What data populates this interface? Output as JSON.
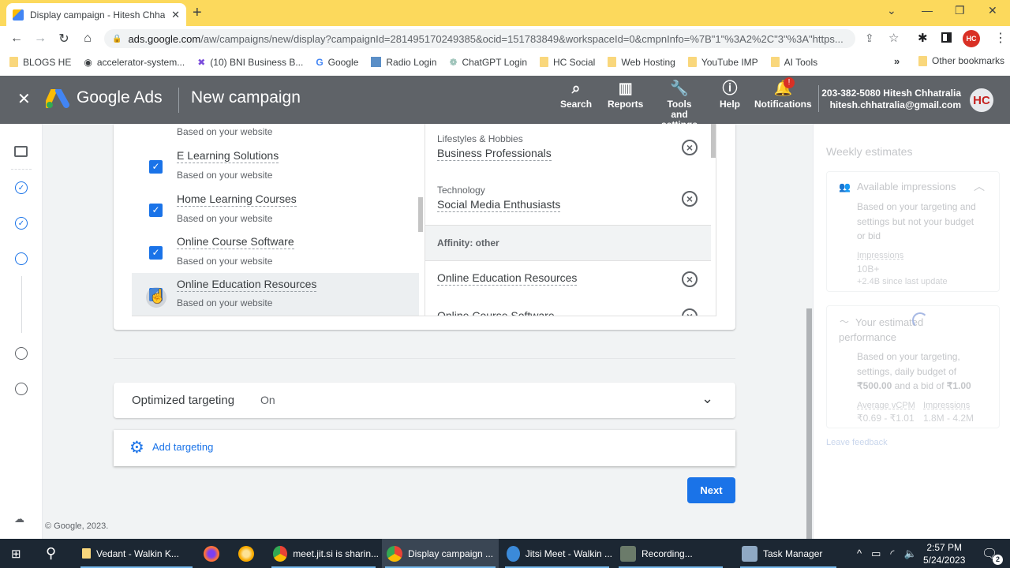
{
  "browser": {
    "tab_title": "Display campaign - Hitesh Chhatralia",
    "url_host": "ads.google.com",
    "url_path": "/aw/campaigns/new/display?campaignId=281495170249385&ocid=151783849&workspaceId=0&cmpnInfo=%7B\"1\"%3A2%2C\"3\"%3A\"https...",
    "bookmarks": [
      "BLOGS HE",
      "accelerator-system...",
      "(10) BNI Business B...",
      "Google",
      "Radio Login",
      "ChatGPT Login",
      "HC Social",
      "Web Hosting",
      "YouTube IMP",
      "AI Tools"
    ],
    "other_bookmarks": "Other bookmarks",
    "more_bookmarks": "»"
  },
  "header": {
    "brand": "Google Ads",
    "title": "New campaign",
    "buttons": [
      {
        "label": "Search",
        "icon": "search-icon"
      },
      {
        "label": "Reports",
        "icon": "reports-icon"
      },
      {
        "label": "Tools and settings",
        "icon": "wrench-icon"
      },
      {
        "label": "Help",
        "icon": "help-icon"
      },
      {
        "label": "Notifications",
        "icon": "bell-icon"
      }
    ],
    "notification_badge": "!",
    "account_line1": "203-382-5080 Hitesh Chhatralia",
    "account_line2": "hitesh.chhatralia@gmail.com",
    "avatar_initials": "HC"
  },
  "audience_list": {
    "top_partial_sub": "Based on your website",
    "items": [
      {
        "name": "E Learning Solutions",
        "sub": "Based on your website",
        "checked": true
      },
      {
        "name": "Home Learning Courses",
        "sub": "Based on your website",
        "checked": true
      },
      {
        "name": "Online Course Software",
        "sub": "Based on your website",
        "checked": true
      },
      {
        "name": "Online Education Resources",
        "sub": "Based on your website",
        "checked": true
      }
    ]
  },
  "selected_list": {
    "items": [
      {
        "category": "Lifestyles & Hobbies",
        "name": "Business Professionals"
      },
      {
        "category": "Technology",
        "name": "Social Media Enthusiasts"
      }
    ],
    "group_label": "Affinity: other",
    "group_items": [
      {
        "name": "Online Education Resources"
      },
      {
        "name": "Online Course Software"
      }
    ]
  },
  "optimized_targeting": {
    "label": "Optimized targeting",
    "value": "On"
  },
  "add_targeting_label": "Add targeting",
  "next_label": "Next",
  "footer": "© Google, 2023.",
  "weekly": {
    "title": "Weekly estimates",
    "available": {
      "heading": "Available impressions",
      "desc": "Based on your targeting and settings but not your budget or bid",
      "metric_label": "Impressions",
      "metric_value": "10B+",
      "delta": "+2.4B since last update"
    },
    "performance": {
      "heading": "Your estimated performance",
      "desc_pre": "Based on your targeting, settings, daily budget of ",
      "budget": "₹500.00",
      "desc_mid": " and a bid of ",
      "bid": "₹1.00",
      "col1_label": "Average vCPM",
      "col1_value": "₹0.69 - ₹1.01",
      "col2_label": "Impressions",
      "col2_value": "1.8M - 4.2M"
    },
    "feedback": "Leave feedback"
  },
  "taskbar": {
    "items": [
      "Vedant  - Walkin K...",
      "meet.jit.si is sharin...",
      "Display campaign ...",
      "Jitsi Meet - Walkin ...",
      "Recording...",
      "Task Manager"
    ],
    "time": "2:57 PM",
    "date": "5/24/2023",
    "notifications_count": "2"
  }
}
